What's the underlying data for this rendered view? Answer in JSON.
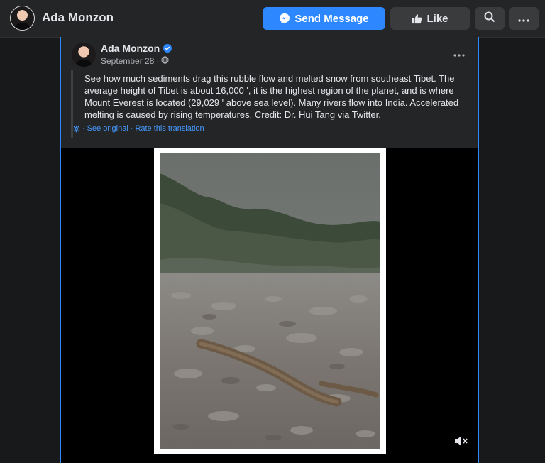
{
  "topbar": {
    "page_name": "Ada Monzon",
    "send_message_label": "Send Message",
    "like_label": "Like"
  },
  "post": {
    "author": "Ada Monzon",
    "date": "September 28",
    "text": "See how much sediments drag this rubble flow and melted snow from southeast Tibet. The average height of Tibet is about 16,000 ', it is the highest region of the planet, and is where Mount Everest is located (29,029 ' above sea level). Many rivers flow into India. Accelerated melting is caused by rising temperatures. Credit: Dr. Hui Tang via Twitter.",
    "see_original": "See original",
    "rate_translation": "Rate this translation",
    "separator": "·"
  },
  "colors": {
    "accent": "#2d88ff",
    "background": "#18191a",
    "surface": "#242526",
    "button": "#3a3b3c",
    "link": "#4599ff"
  },
  "icons": [
    "messenger-icon",
    "thumbs-up-icon",
    "search-icon",
    "more-icon",
    "verified-badge-icon",
    "globe-icon",
    "gear-icon",
    "mute-icon"
  ]
}
